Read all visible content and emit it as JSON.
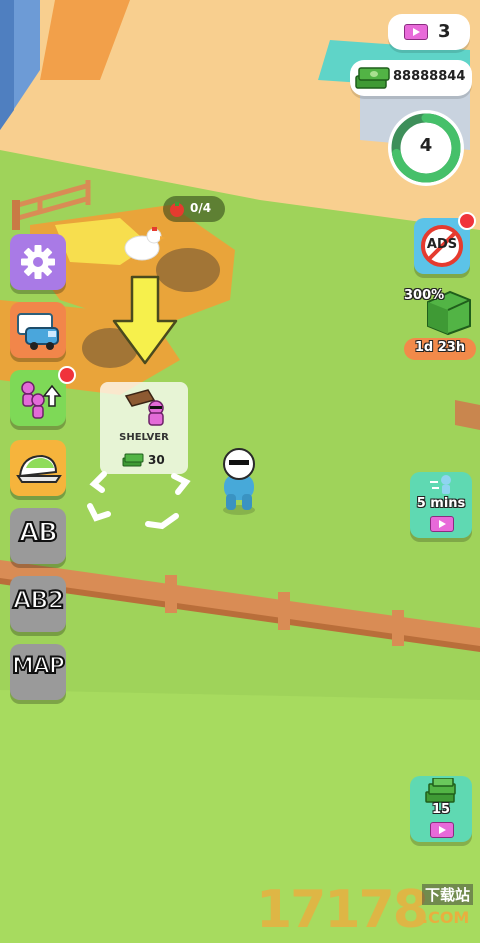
{
  "hud": {
    "tickets": "3",
    "cash": "88888844",
    "level": "4",
    "progress": 0.72
  },
  "pen": {
    "eggs": "0/4"
  },
  "build_card": {
    "name": "SHELVER",
    "cost": "30"
  },
  "side_menu": {
    "ab_label": "AB",
    "ab2_label": "AB2",
    "map_label": "MAP"
  },
  "right_menu": {
    "ads_label": "ADS",
    "boost_percent": "300%",
    "boost_timer": "1d 23h",
    "speed_label": "5 mins",
    "cash_pack_label": "15"
  },
  "watermark": {
    "number": "17178",
    "site_top": "下载站",
    "site_bottom": ".COM"
  },
  "colors": {
    "grass": "#9fd35a",
    "floor": "#f8cf8f",
    "pen": "#e9a43a",
    "fence": "#d98c55"
  }
}
